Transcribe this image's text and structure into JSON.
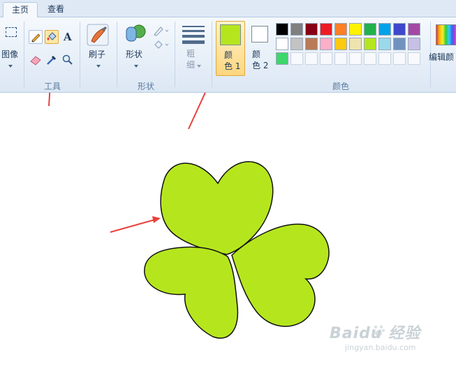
{
  "tabs": {
    "home": "主页",
    "view": "查看"
  },
  "groups": {
    "image": "图像",
    "tools": "工具",
    "brushes": "刷子",
    "shapes_btn": "形状",
    "shapes_group": "形状",
    "size": "粗\n细",
    "color1": "颜\n色 1",
    "color2": "颜\n色 2",
    "colors": "颜色",
    "edit_colors": "编辑颜"
  },
  "colors": {
    "color1": "#b5e61d",
    "color2": "#ffffff",
    "accent_arrow": "#e8413c",
    "palette_row1": [
      "#000000",
      "#7f7f7f",
      "#880015",
      "#ed1c24",
      "#ff7f27",
      "#fff200",
      "#22b14c",
      "#00a2e8",
      "#3f48cc",
      "#a349a4"
    ],
    "palette_row2": [
      "#ffffff",
      "#c3c3c3",
      "#b97a57",
      "#ffaec9",
      "#ffc90e",
      "#efe4b0",
      "#b5e61d",
      "#99d9ea",
      "#7092be",
      "#c8bfe7"
    ],
    "palette_row3_first": "#3fd66b",
    "shape_fill": "#b5e61d"
  },
  "watermark": {
    "brand": "Baidu 经验",
    "url": "jingyan.baidu.com"
  }
}
